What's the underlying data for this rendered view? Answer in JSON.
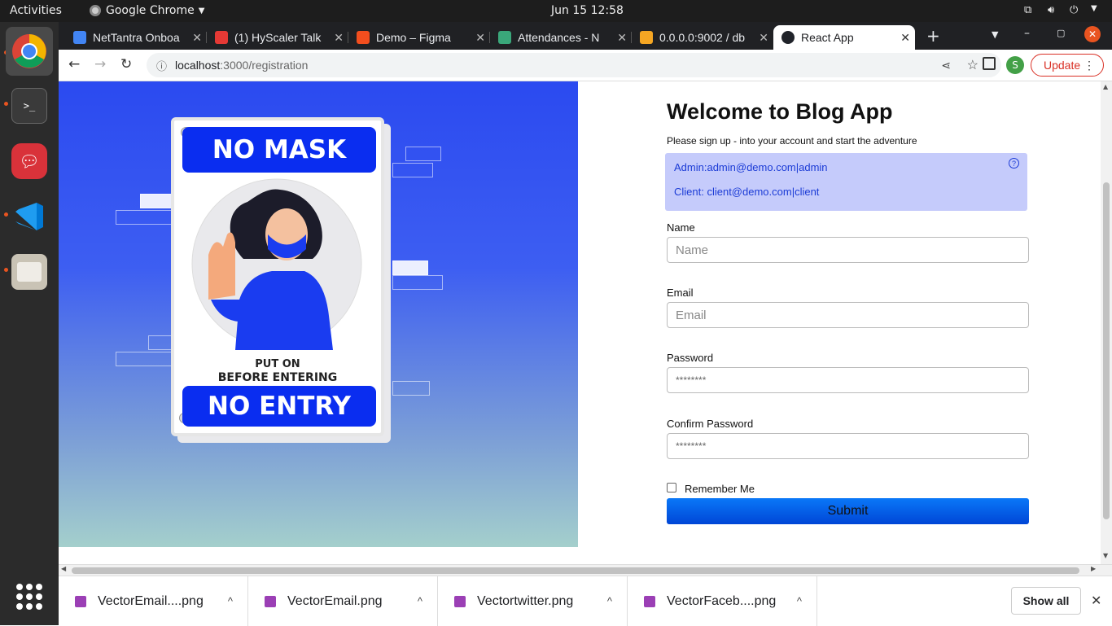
{
  "topbar": {
    "activities": "Activities",
    "app_name": "Google Chrome",
    "datetime": "Jun 15  12:58"
  },
  "tabs": [
    {
      "title": "NetTantra Onboa",
      "icon": "docs-icon",
      "color": "#4285f4"
    },
    {
      "title": "(1) HyScaler Talk",
      "icon": "hyscaler-icon",
      "color": "#e53935"
    },
    {
      "title": "Demo – Figma",
      "icon": "figma-icon",
      "color": "#f24e1e"
    },
    {
      "title": "Attendances - N",
      "icon": "attendance-icon",
      "color": "#3aa77a"
    },
    {
      "title": "0.0.0.0:9002 / db",
      "icon": "pma-icon",
      "color": "#f5a623"
    },
    {
      "title": "React App",
      "icon": "react-icon",
      "color": "#61dafb"
    }
  ],
  "toolbar": {
    "url_host": "localhost",
    "url_path": ":3000/registration",
    "profile_initial": "S",
    "update_label": "Update"
  },
  "hero": {
    "sign_top": "NO MASK",
    "sign_line1": "PUT ON",
    "sign_line2": "BEFORE ENTERING",
    "sign_bottom": "NO ENTRY"
  },
  "form": {
    "title": "Welcome to Blog App",
    "subtitle": "Please sign up - into your account and start the adventure",
    "info_admin": "Admin:admin@demo.com|admin",
    "info_client": "Client: client@demo.com|client",
    "name_label": "Name",
    "name_placeholder": "Name",
    "email_label": "Email",
    "email_placeholder": "Email",
    "password_label": "Password",
    "password_value": "********",
    "confirm_label": "Confirm Password",
    "confirm_value": "********",
    "remember_label": "Remember Me",
    "submit_label": "Submit"
  },
  "downloads": {
    "items": [
      "VectorEmail....png",
      "VectorEmail.png",
      "Vectortwitter.png",
      "VectorFaceb....png"
    ],
    "show_all": "Show all"
  }
}
